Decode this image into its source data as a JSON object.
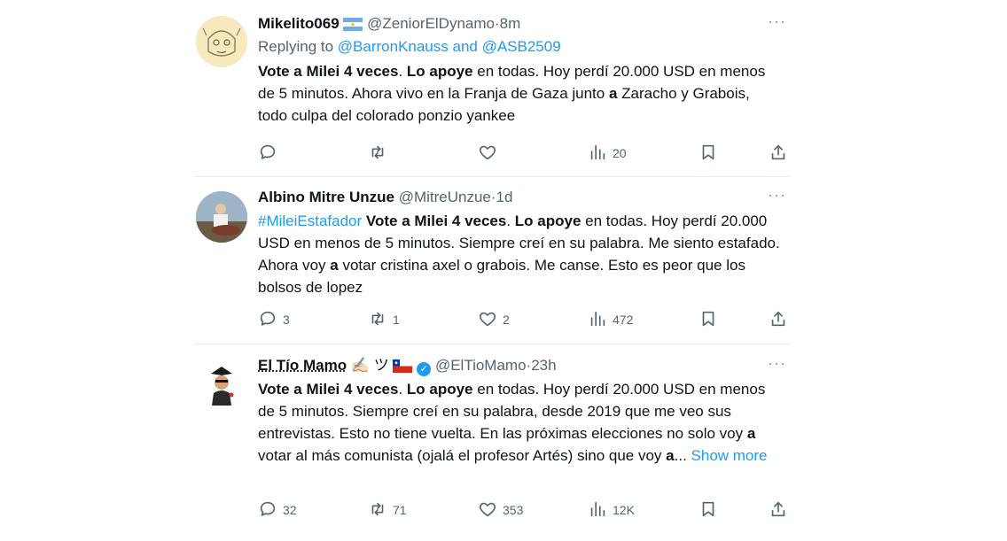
{
  "tweets": [
    {
      "name": "Mikelito069",
      "flag": "argentina-flag",
      "handle": "@ZeniorElDynamo",
      "dot": "·",
      "time": "8m",
      "reply_prefix": "Replying to ",
      "reply_to": "@BarronKnauss and @ASB2509",
      "body": [
        {
          "t": "Vote a Milei 4 veces",
          "b": true
        },
        {
          "t": ". ",
          "b": false
        },
        {
          "t": "Lo apoye",
          "b": true
        },
        {
          "t": " en todas. Hoy perdí 20.000 USD en menos de 5 minutos. Ahora vivo en la Franja de Gaza junto ",
          "b": false
        },
        {
          "t": "a",
          "b": true
        },
        {
          "t": " Zaracho y Grabois, todo culpa del colorado ponzio yankee",
          "b": false
        }
      ],
      "replies": "",
      "retweets": "",
      "likes": "",
      "views": "20"
    },
    {
      "name": "Albino Mitre Unzue",
      "handle": "@MitreUnzue",
      "dot": "·",
      "time": "1d",
      "hashtag": "#MileiEstafador",
      "body": [
        {
          "t": " ",
          "b": false
        },
        {
          "t": "Vote a Milei 4 veces",
          "b": true
        },
        {
          "t": ". ",
          "b": false
        },
        {
          "t": "Lo apoye",
          "b": true
        },
        {
          "t": " en todas. Hoy perdí 20.000 USD en menos de 5 minutos. Siempre creí en su palabra. Me siento estafado. Ahora voy ",
          "b": false
        },
        {
          "t": "a",
          "b": true
        },
        {
          "t": " votar cristina axel o grabois. Me canse. Esto es peor que los bolsos de lopez",
          "b": false
        }
      ],
      "replies": "3",
      "retweets": "1",
      "likes": "2",
      "views": "472"
    },
    {
      "name": "El Tío Mamo",
      "emoji": "✍🏻 ツ",
      "flag": "chile-flag",
      "handle": "@ElTioMamo",
      "dot": "·",
      "time": "23h",
      "body": [
        {
          "t": "Vote a Milei 4 veces",
          "b": true
        },
        {
          "t": ". ",
          "b": false
        },
        {
          "t": "Lo apoye",
          "b": true
        },
        {
          "t": " en todas. Hoy perdí 20.000 USD en menos de 5 minutos. Siempre creí en su palabra, desde 2019 que me veo sus entrevistas. Esto no tiene vuelta. En las próximas elecciones no solo voy ",
          "b": false
        },
        {
          "t": "a",
          "b": true
        },
        {
          "t": " votar al más comunista (ojalá el profesor Artés) sino que voy ",
          "b": false
        },
        {
          "t": "a",
          "b": true
        },
        {
          "t": "...",
          "b": false
        }
      ],
      "show_more": "Show more",
      "replies": "32",
      "retweets": "71",
      "likes": "353",
      "views": "12K"
    }
  ],
  "more_icon": "more-dots-icon",
  "colors": {
    "link": "#1d9bf0",
    "muted": "#536471",
    "text": "#0f1419",
    "verified": "#1d9bf0"
  }
}
